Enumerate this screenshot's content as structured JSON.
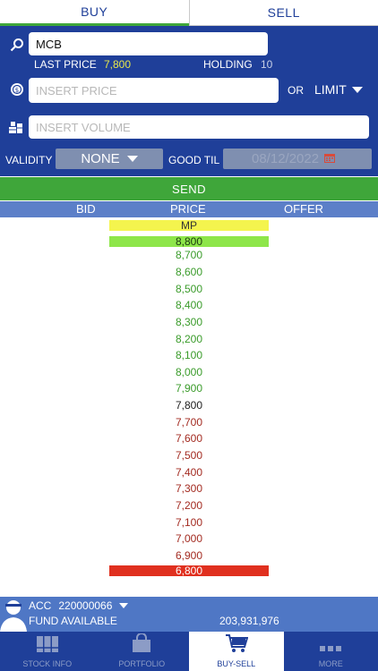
{
  "tabs": {
    "buy": "BUY",
    "sell": "SELL"
  },
  "form": {
    "symbol_value": "MCB",
    "last_price_label": "LAST PRICE",
    "last_price_value": "7,800",
    "holding_label": "HOLDING",
    "holding_value": "10",
    "price_placeholder": "INSERT PRICE",
    "or_label": "OR",
    "order_type": "LIMIT",
    "volume_placeholder": "INSERT VOLUME",
    "validity_label": "VALIDITY",
    "validity_value": "NONE",
    "good_til_label": "GOOD TIL",
    "good_til_value": "08/12/2022"
  },
  "send_label": "SEND",
  "book_header": {
    "bid": "BID",
    "price": "PRICE",
    "offer": "OFFER"
  },
  "ladder": {
    "mp": "MP",
    "prices": [
      "8,800",
      "8,700",
      "8,600",
      "8,500",
      "8,400",
      "8,300",
      "8,200",
      "8,100",
      "8,000",
      "7,900",
      "7,800",
      "7,700",
      "7,600",
      "7,500",
      "7,400",
      "7,300",
      "7,200",
      "7,100",
      "7,000",
      "6,900",
      "6,800"
    ]
  },
  "account": {
    "acc_label": "ACC",
    "acc_number": "220000066",
    "fund_label": "FUND AVAILABLE",
    "fund_value": "203,931,976"
  },
  "nav": {
    "stock_info": "STOCK INFO",
    "portfolio": "PORTFOLIO",
    "buy_sell": "BUY-SELL",
    "more": "MORE"
  },
  "colors": {
    "primary": "#1f3f99",
    "green": "#3fa63a",
    "accent": "#5c7fc8",
    "ceiling": "#8ee64a",
    "floor": "#e0301f",
    "mp": "#f4f44e"
  }
}
